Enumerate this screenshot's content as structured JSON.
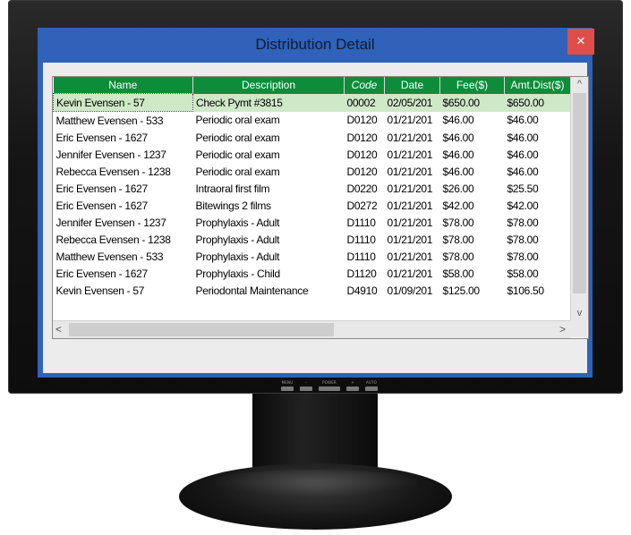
{
  "window": {
    "title": "Distribution Detail",
    "close_glyph": "×"
  },
  "grid": {
    "columns": [
      "Name",
      "Description",
      "Code",
      "Date",
      "Fee($)",
      "Amt.Dist($)"
    ],
    "rows": [
      [
        "Kevin Evensen - 57",
        "Check Pymt #3815",
        "00002",
        "02/05/201",
        "$650.00",
        "$650.00"
      ],
      [
        "Matthew Evensen - 533",
        "Periodic oral exam",
        "D0120",
        "01/21/201",
        "$46.00",
        "$46.00"
      ],
      [
        "Eric Evensen - 1627",
        "Periodic oral exam",
        "D0120",
        "01/21/201",
        "$46.00",
        "$46.00"
      ],
      [
        "Jennifer Evensen - 1237",
        "Periodic oral exam",
        "D0120",
        "01/21/201",
        "$46.00",
        "$46.00"
      ],
      [
        "Rebecca Evensen - 1238",
        "Periodic oral exam",
        "D0120",
        "01/21/201",
        "$46.00",
        "$46.00"
      ],
      [
        "Eric Evensen - 1627",
        "Intraoral first film",
        "D0220",
        "01/21/201",
        "$26.00",
        "$25.50"
      ],
      [
        "Eric Evensen - 1627",
        "Bitewings 2 films",
        "D0272",
        "01/21/201",
        "$42.00",
        "$42.00"
      ],
      [
        "Jennifer Evensen - 1237",
        "Prophylaxis - Adult",
        "D1110",
        "01/21/201",
        "$78.00",
        "$78.00"
      ],
      [
        "Rebecca Evensen - 1238",
        "Prophylaxis - Adult",
        "D1110",
        "01/21/201",
        "$78.00",
        "$78.00"
      ],
      [
        "Matthew Evensen - 533",
        "Prophylaxis - Adult",
        "D1110",
        "01/21/201",
        "$78.00",
        "$78.00"
      ],
      [
        "Eric Evensen - 1627",
        "Prophylaxis - Child",
        "D1120",
        "01/21/201",
        "$58.00",
        "$58.00"
      ],
      [
        "Kevin Evensen - 57",
        "Periodontal Maintenance",
        "D4910",
        "01/09/201",
        "$125.00",
        "$106.50"
      ]
    ],
    "selected_row": 0
  },
  "scrollbars": {
    "up_glyph": "^",
    "down_glyph": "v",
    "left_glyph": "<",
    "right_glyph": ">"
  },
  "monitor": {
    "button_labels": [
      "MENU",
      "-",
      "POWER",
      "+",
      "AUTO"
    ]
  },
  "colors": {
    "titlebar": "#2f62b8",
    "header": "#0d8d3a",
    "selected_row": "#cfe8c8",
    "close": "#e04e4a"
  }
}
